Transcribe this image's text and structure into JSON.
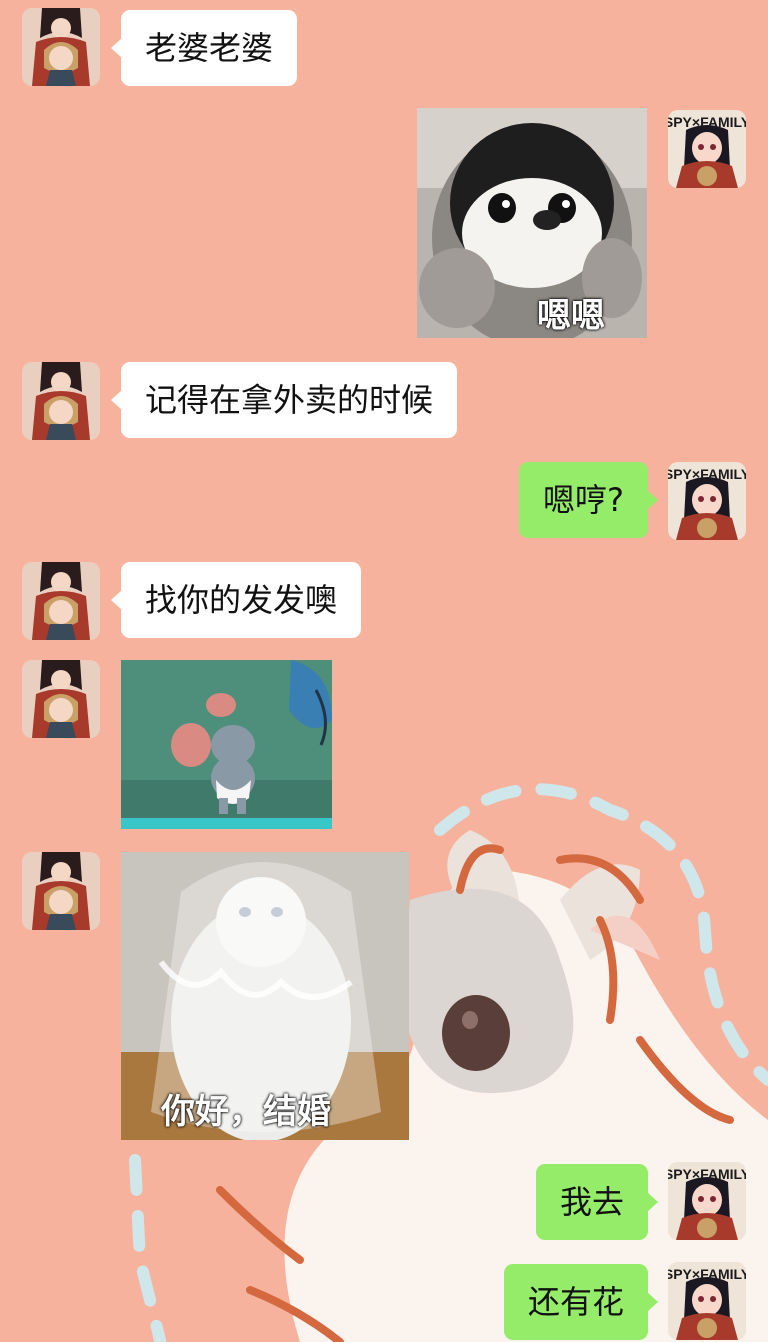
{
  "colors": {
    "background": "#f6b29c",
    "left_bubble": "#ffffff",
    "right_bubble": "#95ec69"
  },
  "avatars": {
    "left": "contact-avatar-anime-couple",
    "right": "self-avatar-spy-family"
  },
  "self_avatar_text": "SPY×FAMILY",
  "messages": [
    {
      "side": "left",
      "type": "text",
      "text": "老婆老婆"
    },
    {
      "side": "right",
      "type": "sticker",
      "sticker": "penguin-plush",
      "caption": "嗯嗯"
    },
    {
      "side": "left",
      "type": "text",
      "text": "记得在拿外卖的时候"
    },
    {
      "side": "right",
      "type": "text",
      "text": "嗯哼?"
    },
    {
      "side": "left",
      "type": "text",
      "text": "找你的发发噢"
    },
    {
      "side": "left",
      "type": "sticker",
      "sticker": "cartoon-mouse"
    },
    {
      "side": "left",
      "type": "sticker",
      "sticker": "cat-with-veil",
      "caption": "你好，结婚"
    },
    {
      "side": "right",
      "type": "text",
      "text": "我去"
    },
    {
      "side": "right",
      "type": "text",
      "text": "还有花"
    }
  ]
}
